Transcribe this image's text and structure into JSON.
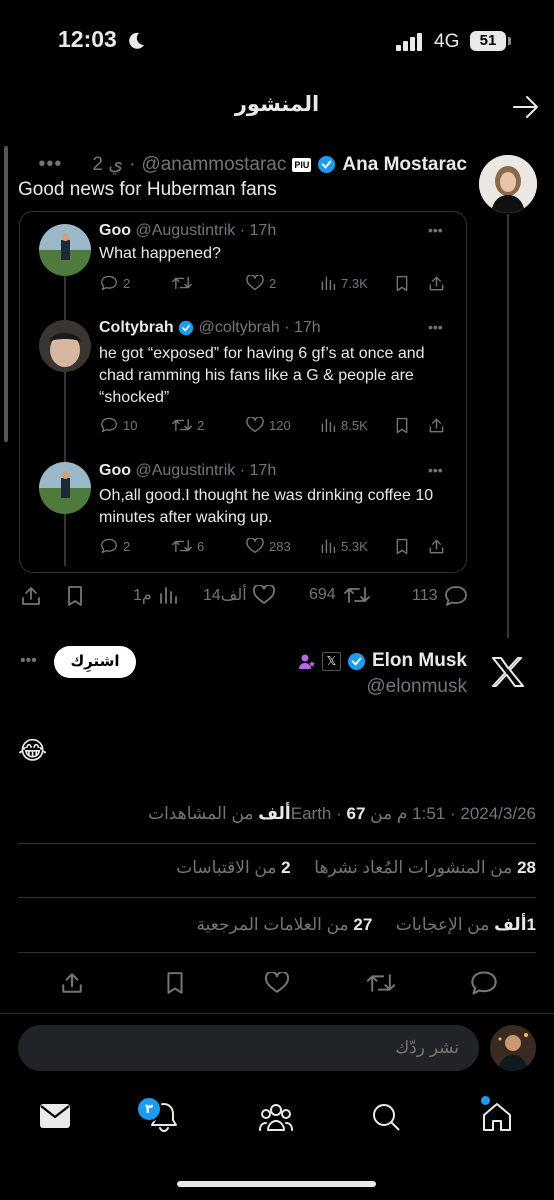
{
  "status_bar": {
    "time": "12:03",
    "network": "4G",
    "battery": "51"
  },
  "header": {
    "title": "المنشور"
  },
  "quoted_post": {
    "author_name": "Ana Mostarac",
    "author_handle": "@anammostarac",
    "time": "2 ي",
    "badge": "PIU",
    "text": "Good news for Huberman fans",
    "replies": [
      {
        "name": "Goo",
        "handle": "@Augustintrik",
        "time": "17h",
        "text": "What happened?",
        "replies": "2",
        "retweets": "",
        "likes": "2",
        "views": "7.3K"
      },
      {
        "name": "Coltybrah",
        "handle": "@coltybrah",
        "time": "17h",
        "text": "he got “exposed” for having 6 gf’s at once and chad ramming his fans like a G & people are “shocked”",
        "replies": "10",
        "retweets": "2",
        "likes": "120",
        "views": "8.5K"
      },
      {
        "name": "Goo",
        "handle": "@Augustintrik",
        "time": "17h",
        "text": "Oh,all good.I thought he was drinking coffee 10 minutes after waking up.",
        "replies": "2",
        "retweets": "6",
        "likes": "283",
        "views": "5.3K"
      }
    ],
    "stats": {
      "replies": "113",
      "retweets": "694",
      "likes": "14ألف",
      "views": "1م"
    }
  },
  "main_post": {
    "author_name": "Elon Musk",
    "author_handle": "@elonmusk",
    "subscribe_label": "اشترِك",
    "text": "😂",
    "meta_time": "2024/3/26 · 1:51 م من Earth · ",
    "meta_views_num": "67ألف",
    "meta_views_label": " من المشاهدات",
    "reposts_num": "28",
    "reposts_label": "من المنشورات المُعاد نشرها",
    "quotes_num": "2",
    "quotes_label": "من الاقتباسات",
    "likes_num": "1ألف",
    "likes_label": "من الإعجابات",
    "bookmarks_num": "27",
    "bookmarks_label": "من العلامات المرجعية"
  },
  "reply_box": {
    "placeholder": "نشر ردّك"
  },
  "bottom_nav": {
    "notifications_badge": "٣"
  },
  "colors": {
    "accent": "#1d9bf0",
    "background": "#000000",
    "muted": "#71767b"
  }
}
